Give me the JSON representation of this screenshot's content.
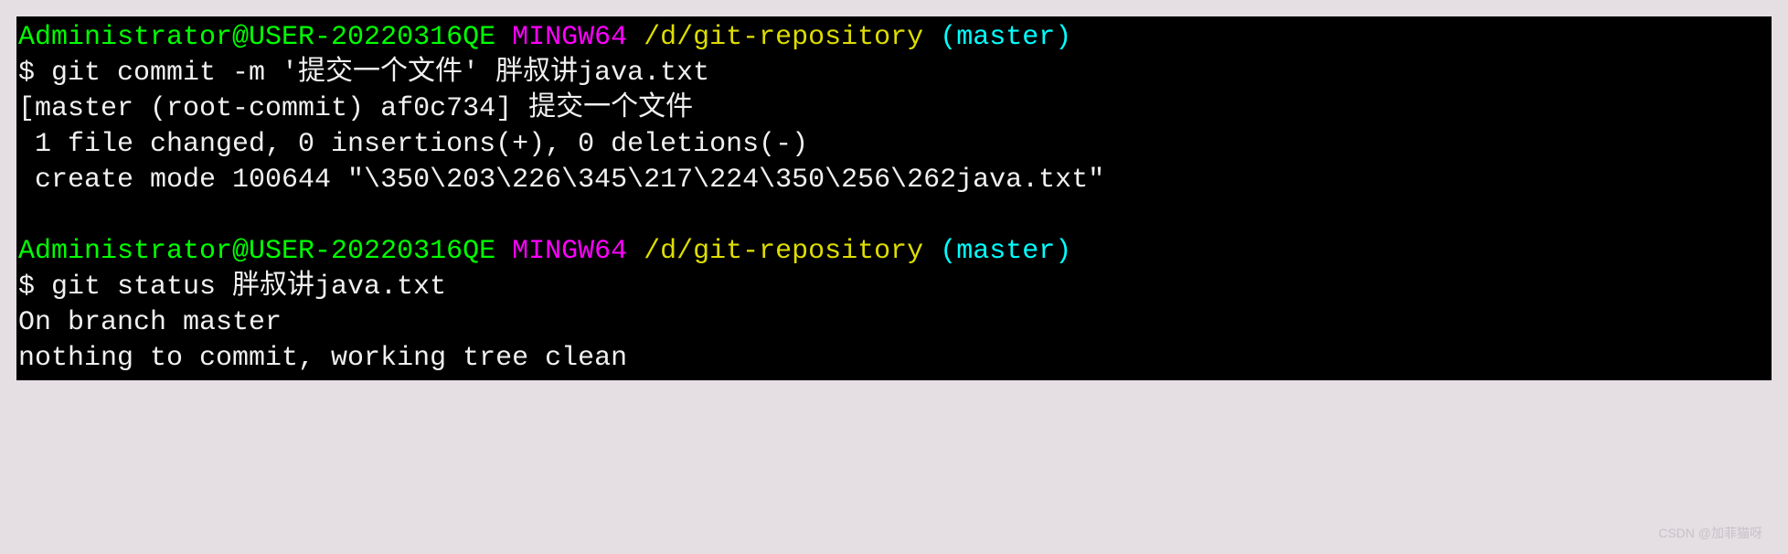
{
  "prompt1": {
    "userhost": "Administrator@USER-20220316QE",
    "mingw": " MINGW64 ",
    "path": "/d/git-repository",
    "branch": " (master)"
  },
  "line2": {
    "prompt": "$ ",
    "cmd": "git commit -m '提交一个文件' 胖叔讲java.txt"
  },
  "line3": "[master (root-commit) af0c734] 提交一个文件",
  "line4": " 1 file changed, 0 insertions(+), 0 deletions(-)",
  "line5": " create mode 100644 \"\\350\\203\\226\\345\\217\\224\\350\\256\\262java.txt\"",
  "blank": " ",
  "prompt2": {
    "userhost": "Administrator@USER-20220316QE",
    "mingw": " MINGW64 ",
    "path": "/d/git-repository",
    "branch": " (master)"
  },
  "line8": {
    "prompt": "$ ",
    "cmd": "git status 胖叔讲java.txt"
  },
  "line9": "On branch master",
  "line10": "nothing to commit, working tree clean",
  "watermark": "CSDN @加菲猫呀"
}
